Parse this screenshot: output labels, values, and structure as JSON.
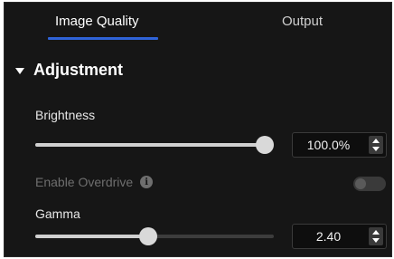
{
  "tabs": [
    {
      "label": "Image Quality",
      "active": true
    },
    {
      "label": "Output",
      "active": false
    }
  ],
  "accent_color": "#2f63d8",
  "section": {
    "title": "Adjustment",
    "expanded": true
  },
  "brightness": {
    "label": "Brightness",
    "value_text": "100.0%",
    "slider_fraction": 1.0
  },
  "overdrive": {
    "label": "Enable Overdrive",
    "enabled": false,
    "disabled": true,
    "info_icon": "info-icon"
  },
  "gamma": {
    "label": "Gamma",
    "value_text": "2.40",
    "slider_fraction": 0.475
  }
}
